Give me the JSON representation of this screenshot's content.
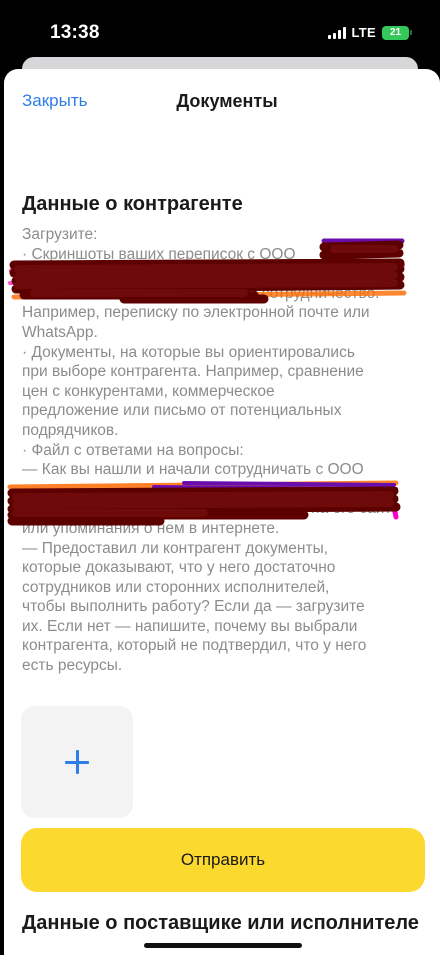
{
  "status_bar": {
    "time": "13:38",
    "network": "LTE",
    "battery": "21"
  },
  "nav": {
    "close_label": "Закрыть",
    "title": "Документы"
  },
  "section": {
    "title": "Данные о контрагенте",
    "lines": [
      "Загрузите:",
      "· Скриншоты ваших переписок с ООО",
      "",
      "где вы обсуждали сотрудничество.",
      "Например, переписку по электронной почте или",
      "WhatsApp.",
      "· Документы, на которые вы ориентировались",
      "при выборе контрагента. Например, сравнение",
      "цен с конкурентами, коммерческое",
      "предложение или письмо от потенциальных",
      "подрядчиков.",
      "· Файл с ответами на вопросы:",
      "— Как вы нашли и начали сотрудничать с ООО",
      "",
      "? Добавьте ссылку на его сайт",
      "или упоминания о нем в интернете.",
      "— Предоставил ли контрагент документы,",
      "которые доказывают, что у него достаточно",
      "сотрудников или сторонних исполнителей,",
      "чтобы выполнить работу? Если да — загрузите",
      "их. Если нет — напишите, почему вы выбрали",
      "контрагента, который не подтвердил, что у него",
      "есть ресурсы."
    ]
  },
  "upload": {
    "icon": "plus-icon"
  },
  "submit_label": "Отправить",
  "next_section_title": "Данные о поставщике или исполнителе",
  "colors": {
    "accent_blue": "#2f7ee8",
    "button_yellow": "#fbd92f",
    "battery_green": "#34c759",
    "redaction": "#5c0000"
  }
}
